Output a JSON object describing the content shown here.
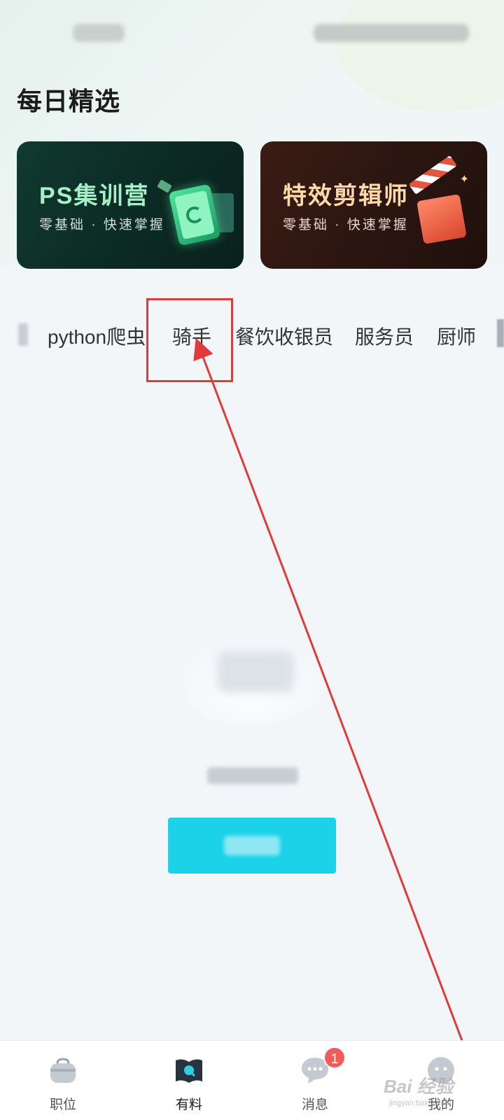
{
  "page": {
    "section_title": "每日精选"
  },
  "banners": [
    {
      "title": "PS集训营",
      "subtitle": "零基础 · 快速掌握"
    },
    {
      "title": "特效剪辑师",
      "subtitle": "零基础 · 快速掌握"
    }
  ],
  "categories": [
    "python爬虫",
    "骑手",
    "餐饮收银员",
    "服务员",
    "厨师"
  ],
  "bottom_nav": {
    "items": [
      {
        "label": "职位",
        "icon": "briefcase-icon"
      },
      {
        "label": "有料",
        "icon": "book-search-icon"
      },
      {
        "label": "消息",
        "icon": "chat-bubble-icon",
        "badge": "1"
      },
      {
        "label": "我的",
        "icon": "profile-face-icon"
      }
    ],
    "active_index": 1
  },
  "watermark": {
    "text": "Bai 经验",
    "sub": "jingyan.baidu.com"
  },
  "colors": {
    "accent": "#1bd2e8",
    "annotation": "#e23a3a",
    "badge": "#f35a5a"
  }
}
